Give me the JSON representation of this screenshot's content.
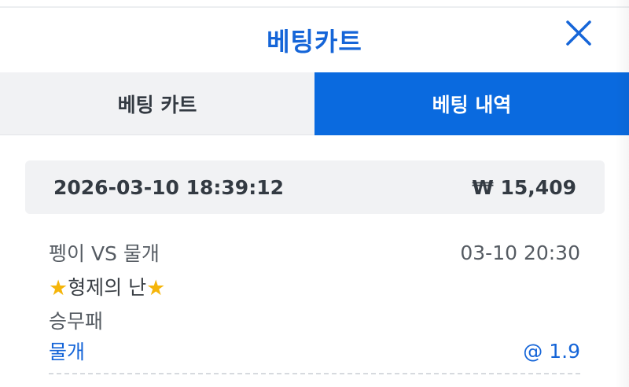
{
  "header": {
    "title": "베팅카트",
    "close_icon": "close-icon"
  },
  "tabs": [
    {
      "label": "베팅 카트",
      "active": false
    },
    {
      "label": "베팅 내역",
      "active": true
    }
  ],
  "bet": {
    "datetime": "2026-03-10 18:39:12",
    "amount": "₩ 15,409",
    "match": "펭이 VS 물개",
    "match_time": "03-10 20:30",
    "league": "형제의 난",
    "market": "승무패",
    "pick": "물개",
    "odds": "@ 1.9"
  },
  "colors": {
    "accent": "#1565d8",
    "active_tab": "#0a6adf",
    "star": "#f5b50a"
  }
}
